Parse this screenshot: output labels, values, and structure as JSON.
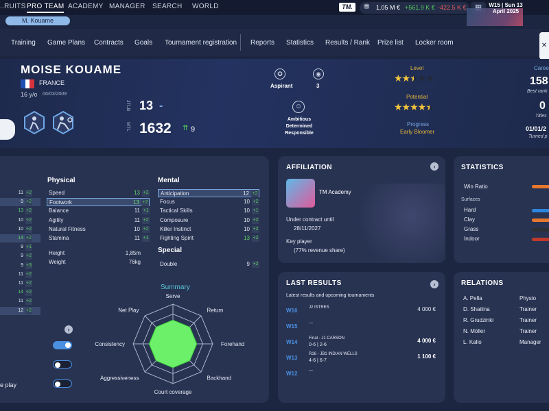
{
  "topnav": {
    "items": [
      "..RUITS",
      "PRO TEAM",
      "ACADEMY",
      "MANAGER",
      "SEARCH",
      "WORLD"
    ],
    "logo": "TM.",
    "balance": "1.05 M €",
    "gain": "+561.9 K €",
    "loss": "-422.5 K €",
    "week_line": "W15 | Sun 13",
    "month_line": "April 2025"
  },
  "player_chip": "M. Kouame",
  "subnav": [
    "Training",
    "Game Plans",
    "Contracts",
    "Goals",
    "Tournament registration",
    "Reports",
    "Statistics",
    "Results / Rank",
    "Prize list",
    "Locker room"
  ],
  "player": {
    "name": "MOISE KOUAME",
    "country": "FRANCE",
    "age": "16 y/o",
    "dob": "06/03/2009",
    "jtlb_label": "JTLB",
    "jtlb": "13",
    "jtlb_dash": "-",
    "mtl_label": "MTL",
    "mtl": "1632",
    "mtl_change": "9",
    "status": "Aspirant",
    "count": "3",
    "traits": [
      "Ambitious",
      "Determined",
      "Responsible"
    ],
    "level_label": "Level",
    "level_stars": 2.5,
    "potential_label": "Potential",
    "potential_stars": 4.5,
    "progress_label": "Progress",
    "progress_value": "Early Bloomer",
    "career_label": "Caree",
    "career_rank": "158",
    "best_rank_label": "Best rank",
    "titles": "0",
    "titles_label": "Titles",
    "turned_pro": "01/01/2",
    "turned_pro_label": "Turned p"
  },
  "left_col": {
    "rows": [
      {
        "v": "11",
        "p": "+2"
      },
      {
        "v": "9",
        "p": "+2"
      },
      {
        "v": "13",
        "p": "+2"
      },
      {
        "v": "10",
        "p": "+2"
      },
      {
        "v": "10",
        "p": "+2"
      },
      {
        "v": "14",
        "p": "+2"
      },
      {
        "v": "9",
        "p": "+1"
      },
      {
        "v": "9",
        "p": "+2"
      },
      {
        "v": "9",
        "p": "+3"
      },
      {
        "v": "11",
        "p": "+2"
      },
      {
        "v": "11",
        "p": "+2"
      },
      {
        "v": "14",
        "p": "+2"
      },
      {
        "v": "11",
        "p": "+2"
      },
      {
        "v": "12",
        "p": "+2"
      }
    ],
    "bottom_label": "e play"
  },
  "physical": {
    "title": "Physical",
    "items": [
      {
        "name": "Speed",
        "value": "13",
        "plus": "+2"
      },
      {
        "name": "Footwork",
        "value": "13",
        "plus": "+2"
      },
      {
        "name": "Balance",
        "value": "11",
        "plus": "+1"
      },
      {
        "name": "Agility",
        "value": "11",
        "plus": "+2"
      },
      {
        "name": "Natural Fitness",
        "value": "10",
        "plus": "+2"
      },
      {
        "name": "Stamina",
        "value": "11",
        "plus": "+1"
      }
    ],
    "height_label": "Height",
    "height": "1,85m",
    "weight_label": "Weight",
    "weight": "76kg"
  },
  "mental": {
    "title": "Mental",
    "items": [
      {
        "name": "Anticipation",
        "value": "12",
        "plus": "+2"
      },
      {
        "name": "Focus",
        "value": "10",
        "plus": "+2"
      },
      {
        "name": "Tactical Skills",
        "value": "10",
        "plus": "+1"
      },
      {
        "name": "Composure",
        "value": "10",
        "plus": "+2"
      },
      {
        "name": "Killer Instinct",
        "value": "10",
        "plus": "+2"
      },
      {
        "name": "Fighting Spirit",
        "value": "13",
        "plus": "+2"
      }
    ]
  },
  "special": {
    "title": "Special",
    "items": [
      {
        "name": "Double",
        "value": "9",
        "plus": "+2"
      }
    ]
  },
  "summary": {
    "title": "Summary",
    "axes": [
      "Serve",
      "Return",
      "Forehand",
      "Backhand",
      "Court coverage",
      "Aggressiveness",
      "Consistency",
      "Net Play"
    ],
    "values": [
      0.6,
      0.6,
      0.6,
      0.6,
      0.6,
      0.6,
      0.6,
      0.6
    ]
  },
  "affiliation": {
    "title": "AFFILIATION",
    "academy": "TM Academy",
    "contract_label": "Under contract until",
    "contract_date": "28/11/2027",
    "key_player": "Key player",
    "revenue": "(77% revenue share)"
  },
  "statistics": {
    "title": "STATISTICS",
    "win_ratio": "Win Ratio",
    "surfaces": "Surfaces",
    "rows": [
      {
        "name": "Hard",
        "color": "#2e86de"
      },
      {
        "name": "Clay",
        "color": "#e8772e"
      },
      {
        "name": "Grass",
        "color": "#2b2f36"
      },
      {
        "name": "Indoor",
        "color": "#c0392b"
      }
    ]
  },
  "last_results": {
    "title": "LAST RESULTS",
    "subtitle": "Latest results and upcoming tournaments",
    "rows": [
      {
        "week": "W16",
        "line1": "J2 ISTRES",
        "line2": "",
        "amount": "4 000 €",
        "bold": false
      },
      {
        "week": "W15",
        "line1": "---",
        "line2": "",
        "amount": "",
        "bold": false
      },
      {
        "week": "W14",
        "line1": "Final - J1 CARSON",
        "line2": "0-6 | 2-6",
        "amount": "4 000 €",
        "bold": true
      },
      {
        "week": "W13",
        "line1": "R16 - JB1 INDIAN WELLS",
        "line2": "4-6 | 6-7",
        "amount": "1 100 €",
        "bold": true
      },
      {
        "week": "W12",
        "line1": "---",
        "line2": "",
        "amount": "",
        "bold": false
      }
    ]
  },
  "relations": {
    "title": "RELATIONS",
    "rows": [
      {
        "name": "A. Pella",
        "role": "Physio"
      },
      {
        "name": "D. Shailina",
        "role": "Trainer"
      },
      {
        "name": "R. Grudzinki",
        "role": "Trainer"
      },
      {
        "name": "N. Möller",
        "role": "Trainer"
      },
      {
        "name": "L. Kallo",
        "role": "Manager"
      }
    ]
  },
  "colors": {
    "accent": "#7aa9e0",
    "gain": "#56c95e",
    "loss": "#e25b5b",
    "gold": "#e0b53c",
    "radar_fill": "#6cf06a"
  }
}
